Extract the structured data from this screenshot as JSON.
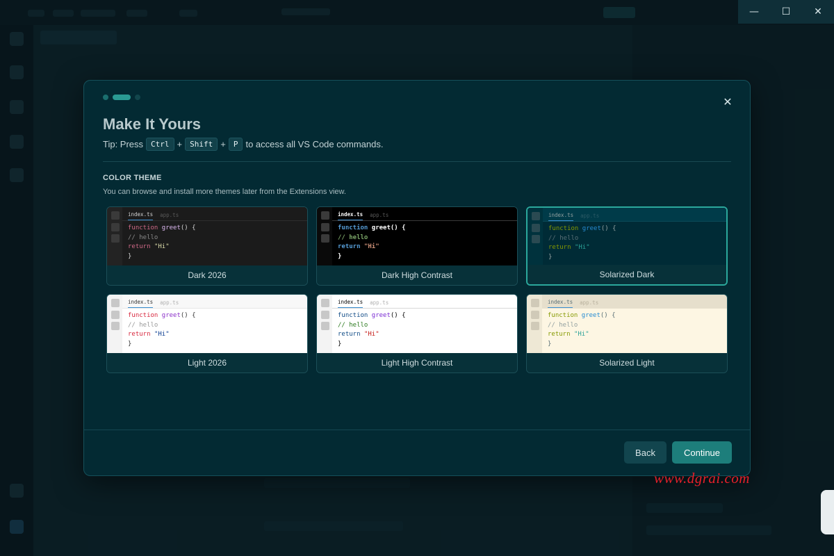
{
  "window": {
    "minimize_glyph": "—",
    "maximize_glyph": "☐",
    "close_glyph": "✕"
  },
  "dialog": {
    "close_glyph": "✕",
    "title": "Make It Yours",
    "tip": {
      "prefix": "Tip: Press",
      "keys": [
        "Ctrl",
        "Shift",
        "P"
      ],
      "plus": "+",
      "suffix": "to access all VS Code commands."
    },
    "section_title": "COLOR THEME",
    "section_desc": "You can browse and install more themes later from the Extensions view.",
    "back_label": "Back",
    "continue_label": "Continue"
  },
  "preview": {
    "tab_active": "index.ts",
    "tab_inactive": "app.ts",
    "code": {
      "kw": "function",
      "fn": "greet",
      "sig": "() {",
      "comment": "// hello",
      "ret": "return",
      "str": "\"Hi\"",
      "close": "}"
    }
  },
  "themes": [
    {
      "name": "Dark 2026",
      "selected": false
    },
    {
      "name": "Dark High Contrast",
      "selected": false
    },
    {
      "name": "Solarized Dark",
      "selected": true
    },
    {
      "name": "Light 2026",
      "selected": false
    },
    {
      "name": "Light High Contrast",
      "selected": false
    },
    {
      "name": "Solarized Light",
      "selected": false
    }
  ],
  "watermark": "www.dgrai.com",
  "colors": {
    "accent": "#2ba89c",
    "dialog_bg": "#032a33",
    "continue_bg": "#1d7e7b"
  }
}
